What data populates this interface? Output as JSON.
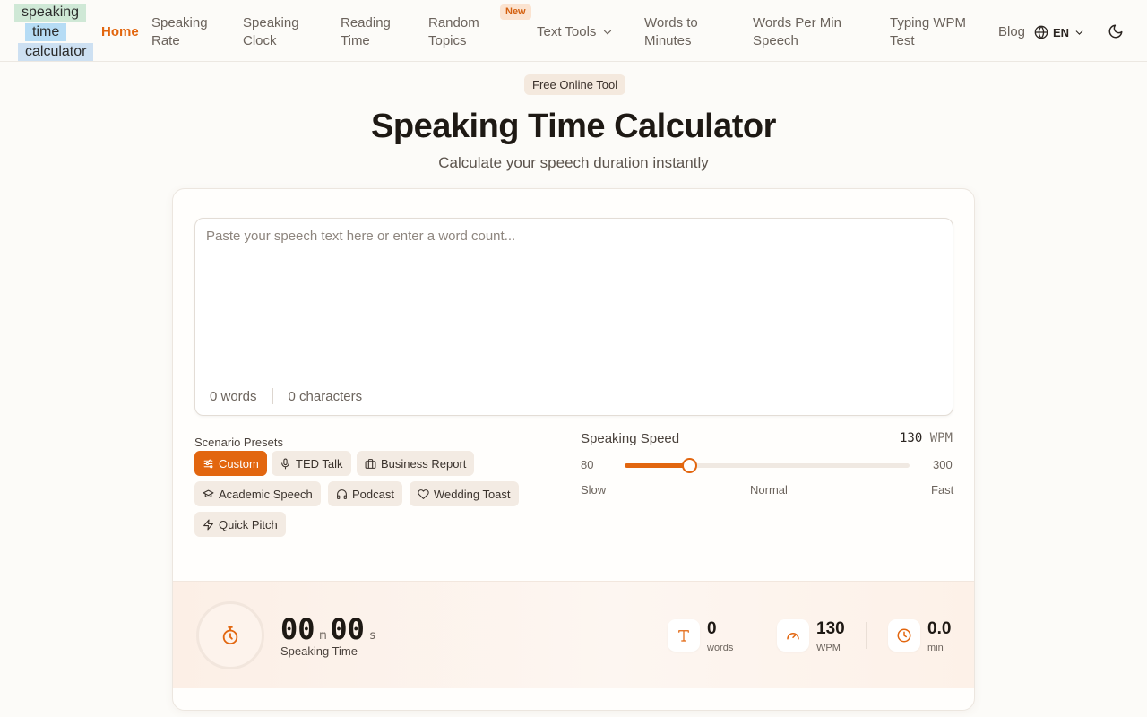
{
  "logo": {
    "line1": "speaking",
    "line2": "time",
    "line3": "calculator"
  },
  "nav": {
    "home": "Home",
    "speaking_rate": "Speaking Rate",
    "speaking_clock": "Speaking Clock",
    "reading_time": "Reading Time",
    "random_topics": "Random Topics",
    "new_badge": "New",
    "text_tools": "Text Tools",
    "words_to_minutes": "Words to Minutes",
    "wpm_speech": "Words Per Min Speech",
    "typing_wpm": "Typing WPM Test",
    "blog": "Blog",
    "language": "EN"
  },
  "hero": {
    "pill": "Free Online Tool",
    "title": "Speaking Time Calculator",
    "subtitle": "Calculate your speech duration instantly"
  },
  "editor": {
    "placeholder": "Paste your speech text here or enter a word count...",
    "value": "",
    "words": "0 words",
    "characters": "0 characters"
  },
  "presets": {
    "label": "Scenario Presets",
    "items": [
      {
        "label": "Custom",
        "icon": "sliders-icon",
        "active": true
      },
      {
        "label": "TED Talk",
        "icon": "microphone-icon",
        "active": false
      },
      {
        "label": "Business Report",
        "icon": "briefcase-icon",
        "active": false
      },
      {
        "label": "Academic Speech",
        "icon": "graduation-cap-icon",
        "active": false
      },
      {
        "label": "Podcast",
        "icon": "headphones-icon",
        "active": false
      },
      {
        "label": "Wedding Toast",
        "icon": "heart-icon",
        "active": false
      },
      {
        "label": "Quick Pitch",
        "icon": "lightning-icon",
        "active": false
      }
    ]
  },
  "speed": {
    "label": "Speaking Speed",
    "value": "130",
    "unit": "WPM",
    "min": "80",
    "max": "300",
    "current": 130,
    "slow": "Slow",
    "normal": "Normal",
    "fast": "Fast"
  },
  "result": {
    "minutes": "00",
    "minutes_unit": "m",
    "seconds": "00",
    "seconds_unit": "s",
    "label": "Speaking Time",
    "stats": [
      {
        "value": "0",
        "unit": "words",
        "icon": "text-icon"
      },
      {
        "value": "130",
        "unit": "WPM",
        "icon": "gauge-icon"
      },
      {
        "value": "0.0",
        "unit": "min",
        "icon": "clock-icon"
      }
    ]
  },
  "colors": {
    "accent": "#e2660f",
    "background": "#fcfbf8",
    "text": "#1f1a17"
  }
}
